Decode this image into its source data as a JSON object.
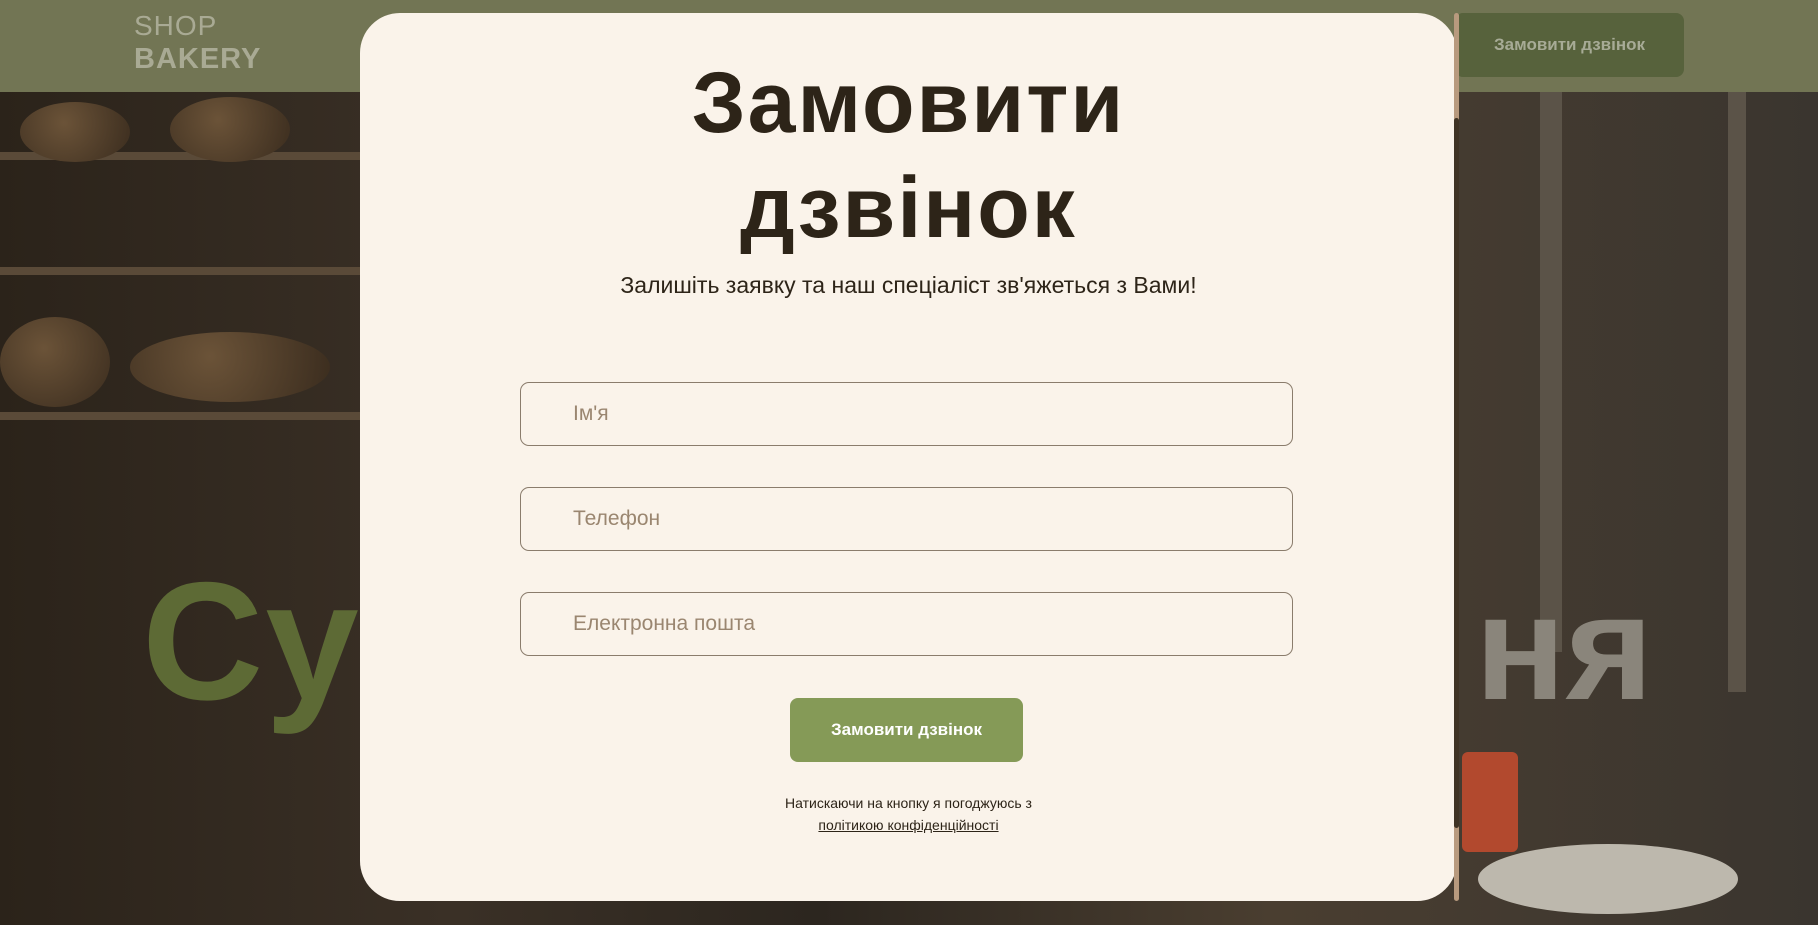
{
  "header": {
    "logo_line1": "SHOP",
    "logo_line2": "BAKERY",
    "cta_label": "Замовити дзвінок"
  },
  "hero": {
    "title_left": "Су",
    "title_right": "ня"
  },
  "modal": {
    "title_line1": "Замовити",
    "title_line2": "дзвінок",
    "subtitle": "Залишіть заявку та наш спеціаліст зв'яжеться з Вами!",
    "fields": {
      "name_placeholder": "Ім'я",
      "phone_placeholder": "Телефон",
      "email_placeholder": "Електронна пошта"
    },
    "submit_label": "Замовити дзвінок",
    "consent_text": "Натискаючи на кнопку я погоджуюсь з",
    "privacy_link": "політикою конфіденційності"
  },
  "colors": {
    "header_bg": "#727554",
    "accent_green": "#859a57",
    "modal_bg": "#faf3ea",
    "text_dark": "#2d2418"
  }
}
